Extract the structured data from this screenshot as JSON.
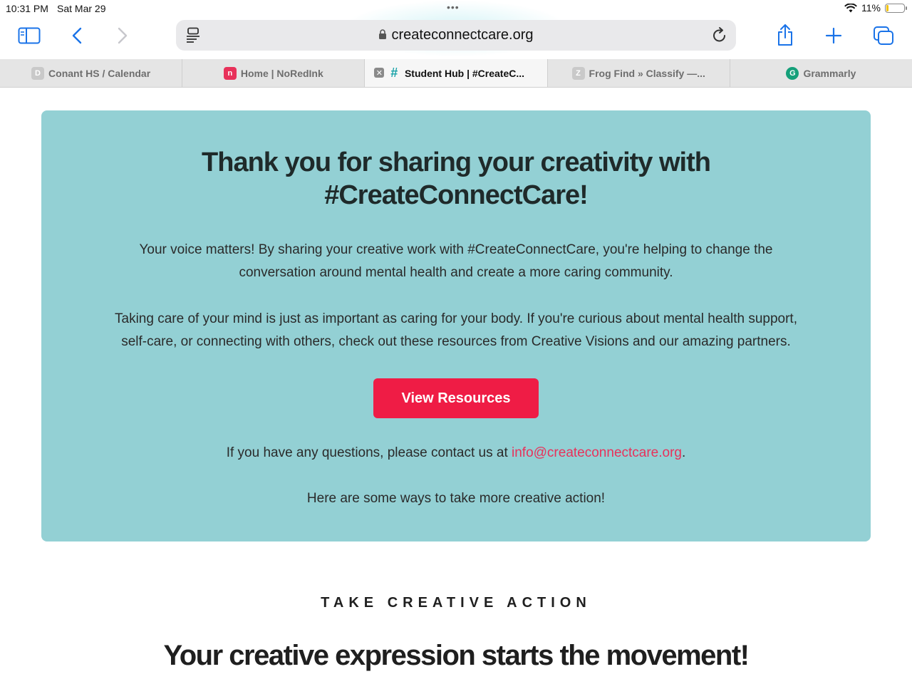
{
  "status_bar": {
    "time": "10:31 PM",
    "date": "Sat Mar 29",
    "battery": "11%",
    "battery_level": 0.11
  },
  "toolbar": {
    "url": "createconnectcare.org",
    "icons": [
      "sidebar-icon",
      "back-icon",
      "forward-icon",
      "reader-icon",
      "lock-icon",
      "reload-icon",
      "share-icon",
      "new-tab-icon",
      "tabs-overview-icon"
    ]
  },
  "tabs": [
    {
      "label": "Conant HS / Calendar",
      "favicon": "D",
      "color": "#c9c9c9",
      "active": false
    },
    {
      "label": "Home | NoRedInk",
      "favicon": "n",
      "color": "#e8315a",
      "active": false
    },
    {
      "label": "Student Hub | #CreateC...",
      "favicon": "#",
      "color": "#1aa3a8",
      "active": true
    },
    {
      "label": "Frog Find » Classify —...",
      "favicon": "Z",
      "color": "#c9c9c9",
      "active": false
    },
    {
      "label": "Grammarly",
      "favicon": "G",
      "color": "#15a07a",
      "active": false
    }
  ],
  "card": {
    "title_line1": "Thank you for sharing your creativity with",
    "title_line2": "#CreateConnectCare!",
    "para1_line1": "Your voice matters! By sharing your creative work with #CreateConnectCare, you're helping to change the",
    "para1_line2": "conversation around mental health and create a more caring community.",
    "para2_line1": "Taking care of your mind is just as important as caring for your body. If you're curious about mental health support,",
    "para2_line2": "self-care, or connecting with others, check out these resources from Creative Visions and our amazing partners.",
    "button_label": "View Resources",
    "contact_prefix": "If you have any questions, please contact us at ",
    "contact_email": "info@createconnectcare.org",
    "contact_suffix": ".",
    "more_actions": "Here are some ways to take more creative action!",
    "bg_color": "#93d0d4",
    "button_color": "#ef1c45"
  },
  "section": {
    "kicker": "TAKE CREATIVE ACTION",
    "headline": "Your creative expression starts the movement!"
  }
}
